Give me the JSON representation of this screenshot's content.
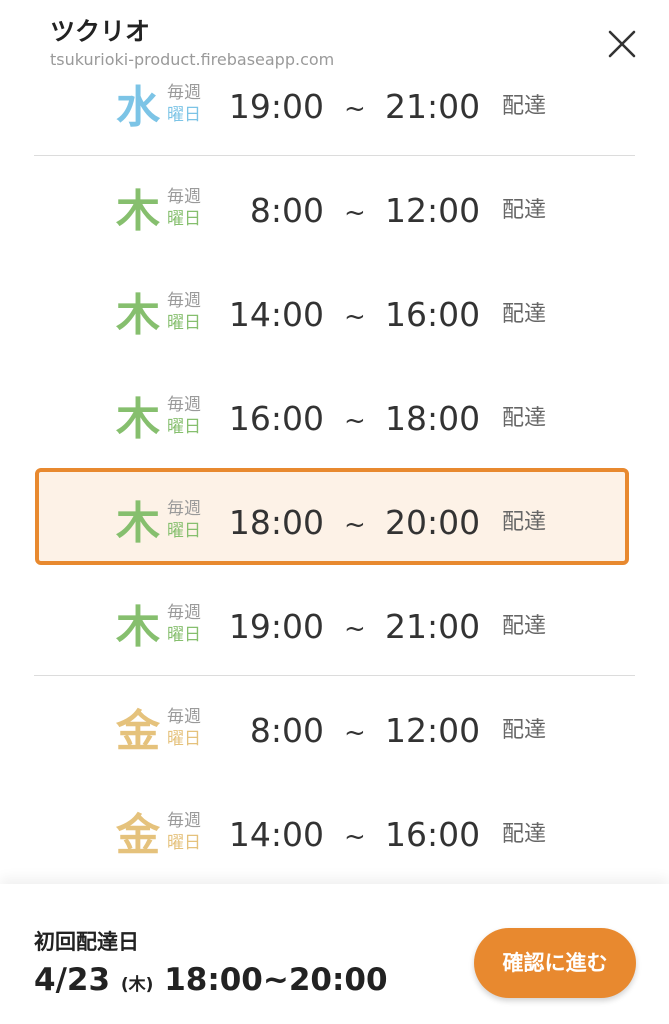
{
  "header": {
    "title": "ツクリオ",
    "url": "tsukurioki-product.firebaseapp.com"
  },
  "colors": {
    "wed": "#7cc4e6",
    "thu": "#86bf6e",
    "fri": "#e5c27c",
    "accent": "#e8892f",
    "selected_bg": "#fdf2e7"
  },
  "slots": [
    {
      "day": "水",
      "weekly": "毎週",
      "weekday": "曜日",
      "start": "19:00",
      "tilde": "~",
      "end": "21:00",
      "suffix": "配達",
      "color": "wed"
    },
    {
      "day": "木",
      "weekly": "毎週",
      "weekday": "曜日",
      "start": "8:00",
      "tilde": "~",
      "end": "12:00",
      "suffix": "配達",
      "color": "thu"
    },
    {
      "day": "木",
      "weekly": "毎週",
      "weekday": "曜日",
      "start": "14:00",
      "tilde": "~",
      "end": "16:00",
      "suffix": "配達",
      "color": "thu"
    },
    {
      "day": "木",
      "weekly": "毎週",
      "weekday": "曜日",
      "start": "16:00",
      "tilde": "~",
      "end": "18:00",
      "suffix": "配達",
      "color": "thu"
    },
    {
      "day": "木",
      "weekly": "毎週",
      "weekday": "曜日",
      "start": "18:00",
      "tilde": "~",
      "end": "20:00",
      "suffix": "配達",
      "color": "thu",
      "selected": true
    },
    {
      "day": "木",
      "weekly": "毎週",
      "weekday": "曜日",
      "start": "19:00",
      "tilde": "~",
      "end": "21:00",
      "suffix": "配達",
      "color": "thu"
    },
    {
      "day": "金",
      "weekly": "毎週",
      "weekday": "曜日",
      "start": "8:00",
      "tilde": "~",
      "end": "12:00",
      "suffix": "配達",
      "color": "fri"
    },
    {
      "day": "金",
      "weekly": "毎週",
      "weekday": "曜日",
      "start": "14:00",
      "tilde": "~",
      "end": "16:00",
      "suffix": "配達",
      "color": "fri"
    }
  ],
  "footer": {
    "label": "初回配達日",
    "date": "4/23",
    "dow": "(木)",
    "time": "18:00~20:00",
    "confirm_label": "確認に進む"
  }
}
